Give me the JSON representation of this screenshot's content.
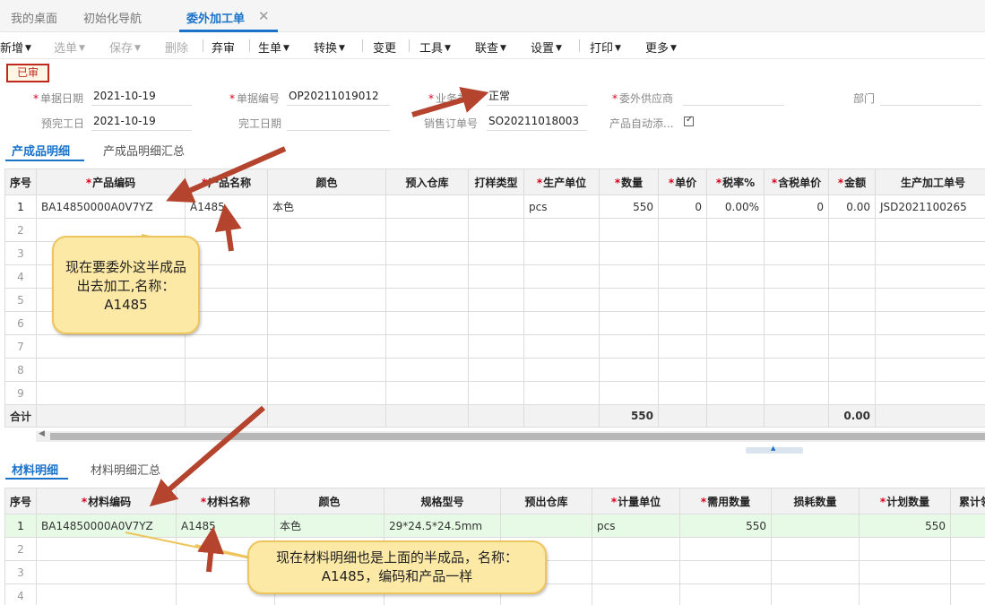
{
  "tabs": [
    "我的桌面",
    "初始化导航",
    "委外加工单"
  ],
  "toolbar": [
    {
      "label": "新增",
      "caret": true,
      "disabled": false
    },
    {
      "label": "选单",
      "caret": true,
      "disabled": true
    },
    {
      "label": "保存",
      "caret": true,
      "disabled": true
    },
    {
      "label": "删除",
      "caret": false,
      "disabled": true
    },
    {
      "label": "弃审",
      "caret": false,
      "disabled": false
    },
    {
      "label": "生单",
      "caret": true,
      "disabled": false
    },
    {
      "label": "转换",
      "caret": true,
      "disabled": false
    },
    {
      "label": "变更",
      "caret": false,
      "disabled": false
    },
    {
      "label": "工具",
      "caret": true,
      "disabled": false
    },
    {
      "label": "联查",
      "caret": true,
      "disabled": false
    },
    {
      "label": "设置",
      "caret": true,
      "disabled": false
    },
    {
      "label": "打印",
      "caret": true,
      "disabled": false
    },
    {
      "label": "更多",
      "caret": true,
      "disabled": false
    }
  ],
  "status_badge": "已审",
  "form": {
    "doc_date_label": "单据日期",
    "doc_date": "2021-10-19",
    "doc_no_label": "单据编号",
    "doc_no": "OP20211019012",
    "biz_type_label": "业务类型",
    "biz_type": "正常",
    "supplier_label": "委外供应商",
    "supplier": "",
    "dept_label": "部门",
    "dept": "",
    "plan_finish_label": "预完工日",
    "plan_finish": "2021-10-19",
    "finish_label": "完工日期",
    "finish": "",
    "sales_order_label": "销售订单号",
    "sales_order": "SO20211018003",
    "auto_add_label": "产品自动添..."
  },
  "product": {
    "tabs": [
      "产成品明细",
      "产成品明细汇总"
    ],
    "columns": [
      {
        "label": "序号",
        "req": false
      },
      {
        "label": "产品编码",
        "req": true
      },
      {
        "label": "产品名称",
        "req": true
      },
      {
        "label": "颜色",
        "req": false
      },
      {
        "label": "预入仓库",
        "req": false
      },
      {
        "label": "打样类型",
        "req": false
      },
      {
        "label": "生产单位",
        "req": true
      },
      {
        "label": "数量",
        "req": true
      },
      {
        "label": "单价",
        "req": true
      },
      {
        "label": "税率%",
        "req": true
      },
      {
        "label": "含税单价",
        "req": true
      },
      {
        "label": "金额",
        "req": true
      },
      {
        "label": "生产加工单号",
        "req": false
      }
    ],
    "row": [
      "1",
      "BA14850000A0V7YZ",
      "A1485",
      "本色",
      "",
      "",
      "pcs",
      "550",
      "0",
      "0.00%",
      "0",
      "0.00",
      "JSD2021100265"
    ],
    "row_count": 9,
    "sum_label": "合计",
    "sum_qty": "550",
    "sum_amount": "0.00"
  },
  "material": {
    "tabs": [
      "材料明细",
      "材料明细汇总"
    ],
    "columns": [
      {
        "label": "序号",
        "req": false
      },
      {
        "label": "材料编码",
        "req": true
      },
      {
        "label": "材料名称",
        "req": true
      },
      {
        "label": "颜色",
        "req": false
      },
      {
        "label": "规格型号",
        "req": false
      },
      {
        "label": "预出仓库",
        "req": false
      },
      {
        "label": "计量单位",
        "req": true
      },
      {
        "label": "需用数量",
        "req": true
      },
      {
        "label": "损耗数量",
        "req": false
      },
      {
        "label": "计划数量",
        "req": true
      },
      {
        "label": "累计领",
        "req": false
      }
    ],
    "row": [
      "1",
      "BA14850000A0V7YZ",
      "A1485",
      "本色",
      "29*24.5*24.5mm",
      "",
      "pcs",
      "550",
      "",
      "550",
      ""
    ],
    "row_count": 4
  },
  "callouts": {
    "product_note": "现在要委外这半成品出去加工,名称：A1485",
    "material_note": "现在材料明细也是上面的半成品，名称：A1485，编码和产品一样"
  },
  "colors": {
    "accent": "#1a73c9",
    "arrow": "#b5442e",
    "callout_bg": "#fde9a6",
    "required": "#d9001b"
  }
}
